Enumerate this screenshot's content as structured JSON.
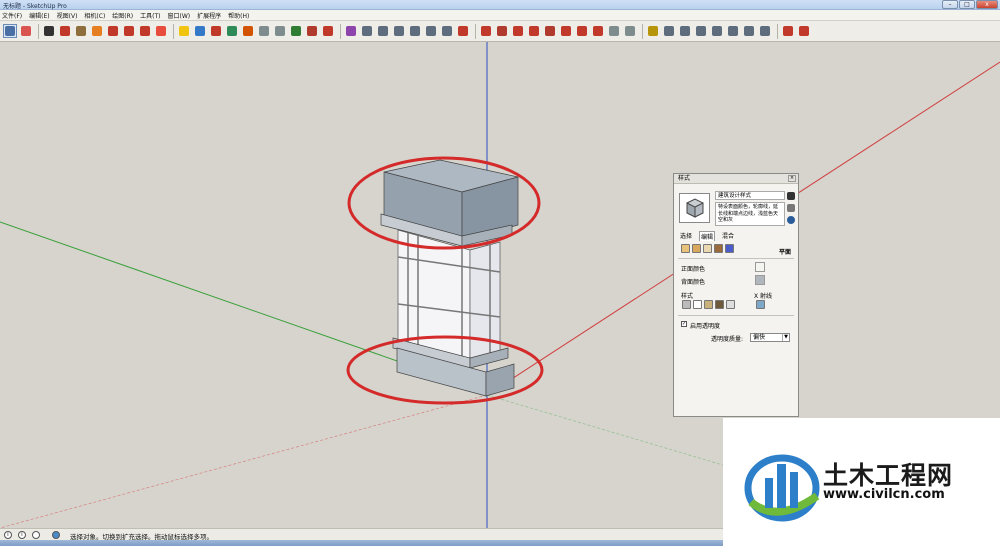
{
  "window": {
    "title": "无标题 - SketchUp Pro",
    "min": "–",
    "max": "□",
    "close": "x"
  },
  "menu": [
    "文件(F)",
    "编辑(E)",
    "视图(V)",
    "相机(C)",
    "绘图(R)",
    "工具(T)",
    "窗口(W)",
    "扩展程序",
    "帮助(H)"
  ],
  "toolbar": {
    "icons": [
      "select-icon",
      "eraser-icon",
      "pencil-icon",
      "arc-icon",
      "rectangle-icon",
      "push-pull-icon",
      "move-icon",
      "rotate-icon",
      "scale-icon",
      "offset-icon",
      "tape-measure-icon",
      "text-icon",
      "paint-bucket-icon",
      "orbit-icon",
      "pan-icon",
      "zoom-icon",
      "zoom-extents-icon",
      "warehouse-icon",
      "components-icon",
      "styles-icon",
      "sandbox-icon",
      "solid-union-icon",
      "solid-subtract-icon",
      "solid-trim-icon",
      "solid-intersect-icon",
      "shell-icon",
      "split-icon",
      "follow-me-icon",
      "line-icon",
      "freehand-icon",
      "circle-icon",
      "polygon-icon",
      "dimension-icon",
      "protractor-icon",
      "axes-icon",
      "section-icon",
      "walk-icon",
      "look-around-icon",
      "position-camera-icon",
      "iso-view-icon",
      "top-view-icon",
      "front-view-icon",
      "right-view-icon",
      "back-view-icon",
      "left-view-icon",
      "xray-icon",
      "shaded-icon",
      "ruby-icon"
    ],
    "colors": [
      "#4a6fa5",
      "#d9534f",
      "#333333",
      "#c0392b",
      "#8e6e3c",
      "#e67e22",
      "#c0392b",
      "#c0392b",
      "#c0392b",
      "#e74c3c",
      "#f1c40f",
      "#3478c8",
      "#c0392b",
      "#2e8b57",
      "#d35400",
      "#7f8c8d",
      "#7f8c8d",
      "#2e7d32",
      "#b03a2e",
      "#c0392b",
      "#8e44ad",
      "#5d6d7e",
      "#5d6d7e",
      "#5d6d7e",
      "#5d6d7e",
      "#5d6d7e",
      "#5d6d7e",
      "#c0392b",
      "#c0392b",
      "#b03a2e",
      "#c0392b",
      "#c0392b",
      "#b03a2e",
      "#c0392b",
      "#c0392b",
      "#c0392b",
      "#7f8c8d",
      "#7f8c8d",
      "#b7950b",
      "#5d6d7e",
      "#5d6d7e",
      "#5d6d7e",
      "#5d6d7e",
      "#5d6d7e",
      "#5d6d7e",
      "#5d6d7e",
      "#c0392b",
      "#c0392b"
    ]
  },
  "styles_panel": {
    "title": "样式",
    "close": "×",
    "style_name": "建筑设计样式",
    "style_desc": "特设表面颜色，轮廓线，延长线和端点边线，浅蓝色天空和灰",
    "tabs": [
      "选择",
      "编辑",
      "混合"
    ],
    "edit_mode": "平面",
    "front_color_label": "正面颜色",
    "back_color_label": "背面颜色",
    "style_label": "样式",
    "xray_label": "X 射线",
    "enable_transparency_label": "启用透明度",
    "transparency_quality_label": "透明度质量:",
    "transparency_quality_value": "偏快",
    "front_color": "#f4f4f0",
    "back_color": "#b0b6bc"
  },
  "status": {
    "text": "选择对象。切换到扩充选择。拖动鼠标选择多项。",
    "icons": [
      "info-icon",
      "help-icon",
      "location-icon"
    ]
  },
  "watermark": {
    "brand": "土木工程网",
    "url": "www.civilcn.com"
  },
  "colors": {
    "highlight_circle": "#d42a2a",
    "axis_red": "#d04040",
    "axis_green": "#3aa03a",
    "axis_blue": "#3050c0",
    "model_top": "#98a5b1",
    "model_glass": "#f5f5f8"
  }
}
